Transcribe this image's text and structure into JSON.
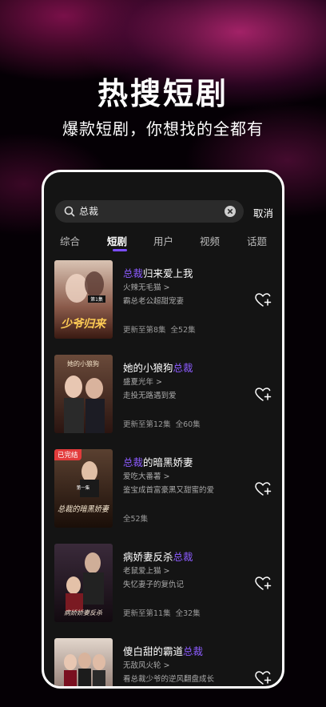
{
  "hero": {
    "title": "热搜短剧",
    "subtitle": "爆款短剧，你想找的全都有"
  },
  "search": {
    "query": "总裁",
    "cancel_label": "取消"
  },
  "tabs": [
    {
      "label": "综合",
      "active": false
    },
    {
      "label": "短剧",
      "active": true
    },
    {
      "label": "用户",
      "active": false
    },
    {
      "label": "视频",
      "active": false
    },
    {
      "label": "话题",
      "active": false
    }
  ],
  "results": [
    {
      "title_parts": [
        "总裁",
        "归来爱上我"
      ],
      "author": "火辣无毛猫 >",
      "desc": "霸总老公超甜宠妻",
      "updated": "更新至第8集",
      "total": "全52集",
      "badge": "",
      "cover_text": "少爷归来",
      "cover_tag": "第1集"
    },
    {
      "title_parts": [
        "她的小狼狗",
        "总裁"
      ],
      "author": "盛夏光年 >",
      "desc": "走投无路遇到爱",
      "updated": "更新至第12集",
      "total": "全60集",
      "badge": "",
      "cover_text": "她的小狼狗"
    },
    {
      "title_parts": [
        "总裁",
        "的暗黑娇妻"
      ],
      "author": "爱吃大番薯 >",
      "desc": "鉴宝成首富豪黑又甜蜜的爱",
      "updated": "",
      "total": "全52集",
      "badge": "已完结",
      "cover_text": "总裁的暗黑娇妻",
      "cover_tag": "第一集"
    },
    {
      "title_parts": [
        "病娇妻反杀",
        "总裁"
      ],
      "author": "老鼠爱上猫 >",
      "desc": "失忆妻子的复仇记",
      "updated": "更新至第11集",
      "total": "全32集",
      "badge": "",
      "cover_text": "病娇娇妻反杀"
    },
    {
      "title_parts": [
        "傻白甜的霸道",
        "总裁"
      ],
      "author": "无敌风火轮 >",
      "desc": "看总裁少爷的逆风翻盘成长",
      "updated": "",
      "total": "",
      "badge": "",
      "cover_text": ""
    }
  ],
  "colors": {
    "accent": "#8c5bff",
    "badge": "#e23b3b",
    "panel": "#141414"
  },
  "icons": {
    "search": "search-icon",
    "clear": "clear-icon",
    "favorite": "heart-plus-icon"
  }
}
